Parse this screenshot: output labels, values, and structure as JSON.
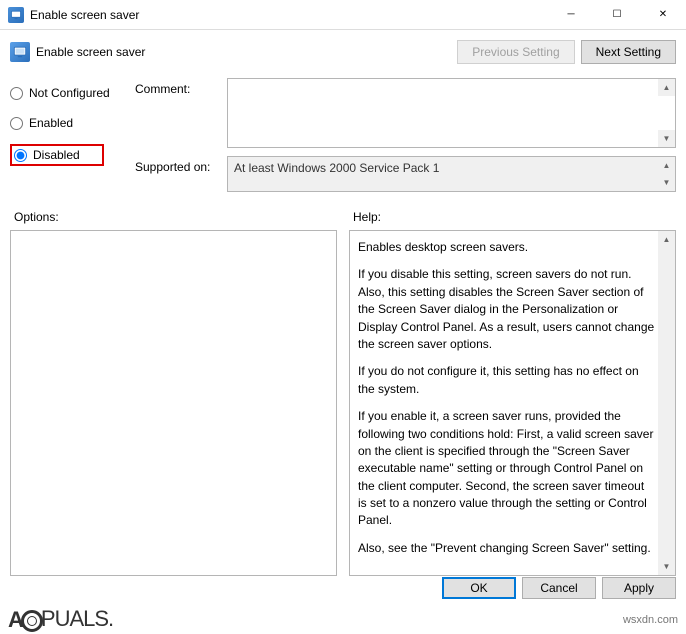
{
  "window": {
    "title": "Enable screen saver",
    "minimize_glyph": "─",
    "maximize_glyph": "☐",
    "close_glyph": "✕"
  },
  "toolbar": {
    "title": "Enable screen saver",
    "prev_label": "Previous Setting",
    "next_label": "Next Setting"
  },
  "radios": {
    "not_configured": "Not Configured",
    "enabled": "Enabled",
    "disabled": "Disabled",
    "selected": "disabled"
  },
  "fields": {
    "comment_label": "Comment:",
    "comment_value": "",
    "supported_label": "Supported on:",
    "supported_value": "At least Windows 2000 Service Pack 1"
  },
  "lower": {
    "options_label": "Options:",
    "help_label": "Help:",
    "options_text": "",
    "help_paragraphs": [
      "Enables desktop screen savers.",
      "If you disable this setting, screen savers do not run. Also, this setting disables the Screen Saver section of the Screen Saver dialog in the Personalization or Display Control Panel. As a result, users cannot change the screen saver options.",
      "If you do not configure it, this setting has no effect on the system.",
      "If you enable it, a screen saver runs, provided the following two conditions hold: First, a valid screen saver on the client is specified through the \"Screen Saver executable name\" setting or through Control Panel on the client computer. Second, the screen saver timeout is set to a nonzero value through the setting or Control Panel.",
      "Also, see the \"Prevent changing Screen Saver\" setting."
    ]
  },
  "footer": {
    "ok": "OK",
    "cancel": "Cancel",
    "apply": "Apply"
  },
  "watermark": {
    "brand": "PUALS.",
    "site": "wsxdn.com"
  },
  "glyphs": {
    "up": "▲",
    "down": "▼"
  }
}
